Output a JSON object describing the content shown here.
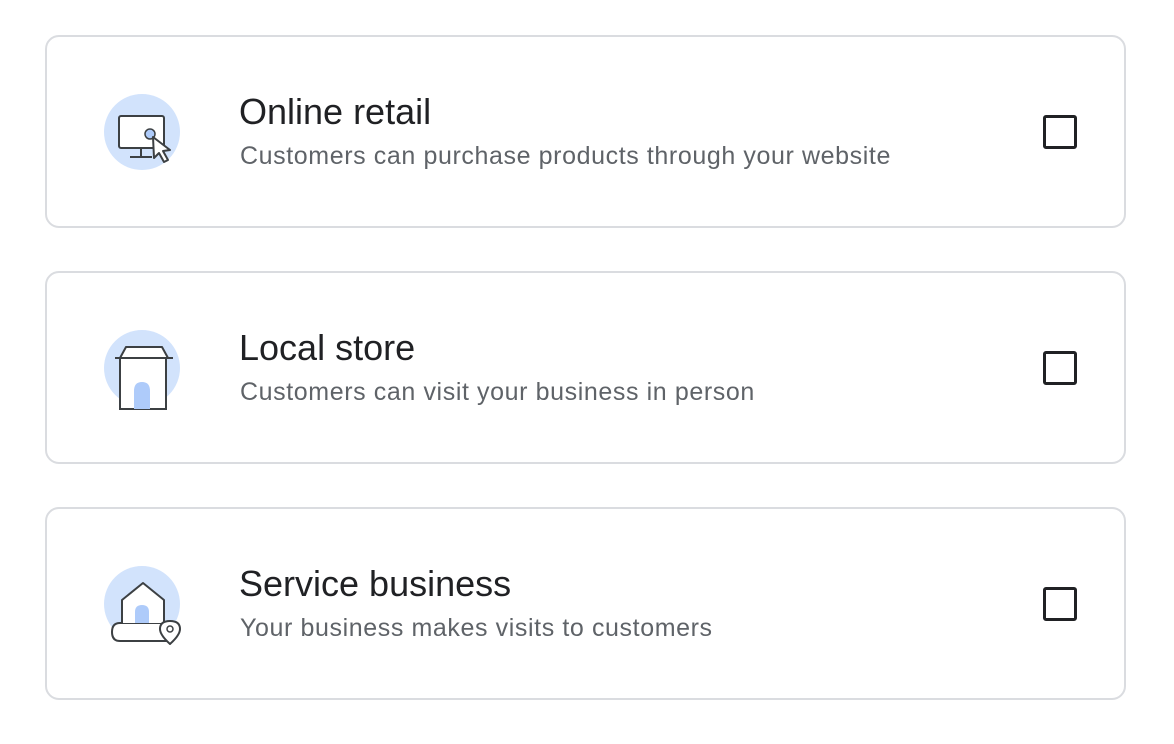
{
  "options": [
    {
      "title": "Online retail",
      "description": "Customers can purchase products through your website",
      "icon": "online-retail-monitor-icon",
      "checked": false
    },
    {
      "title": "Local store",
      "description": "Customers can visit your business in person",
      "icon": "local-store-icon",
      "checked": false
    },
    {
      "title": "Service business",
      "description": "Your business makes visits to customers",
      "icon": "service-business-house-icon",
      "checked": false
    }
  ],
  "colors": {
    "card_border": "#dadce0",
    "title": "#202124",
    "description": "#5f6368",
    "illustration_bg": "#d2e3fc",
    "illustration_accent": "#aecbfa",
    "illustration_stroke": "#3c4043"
  }
}
